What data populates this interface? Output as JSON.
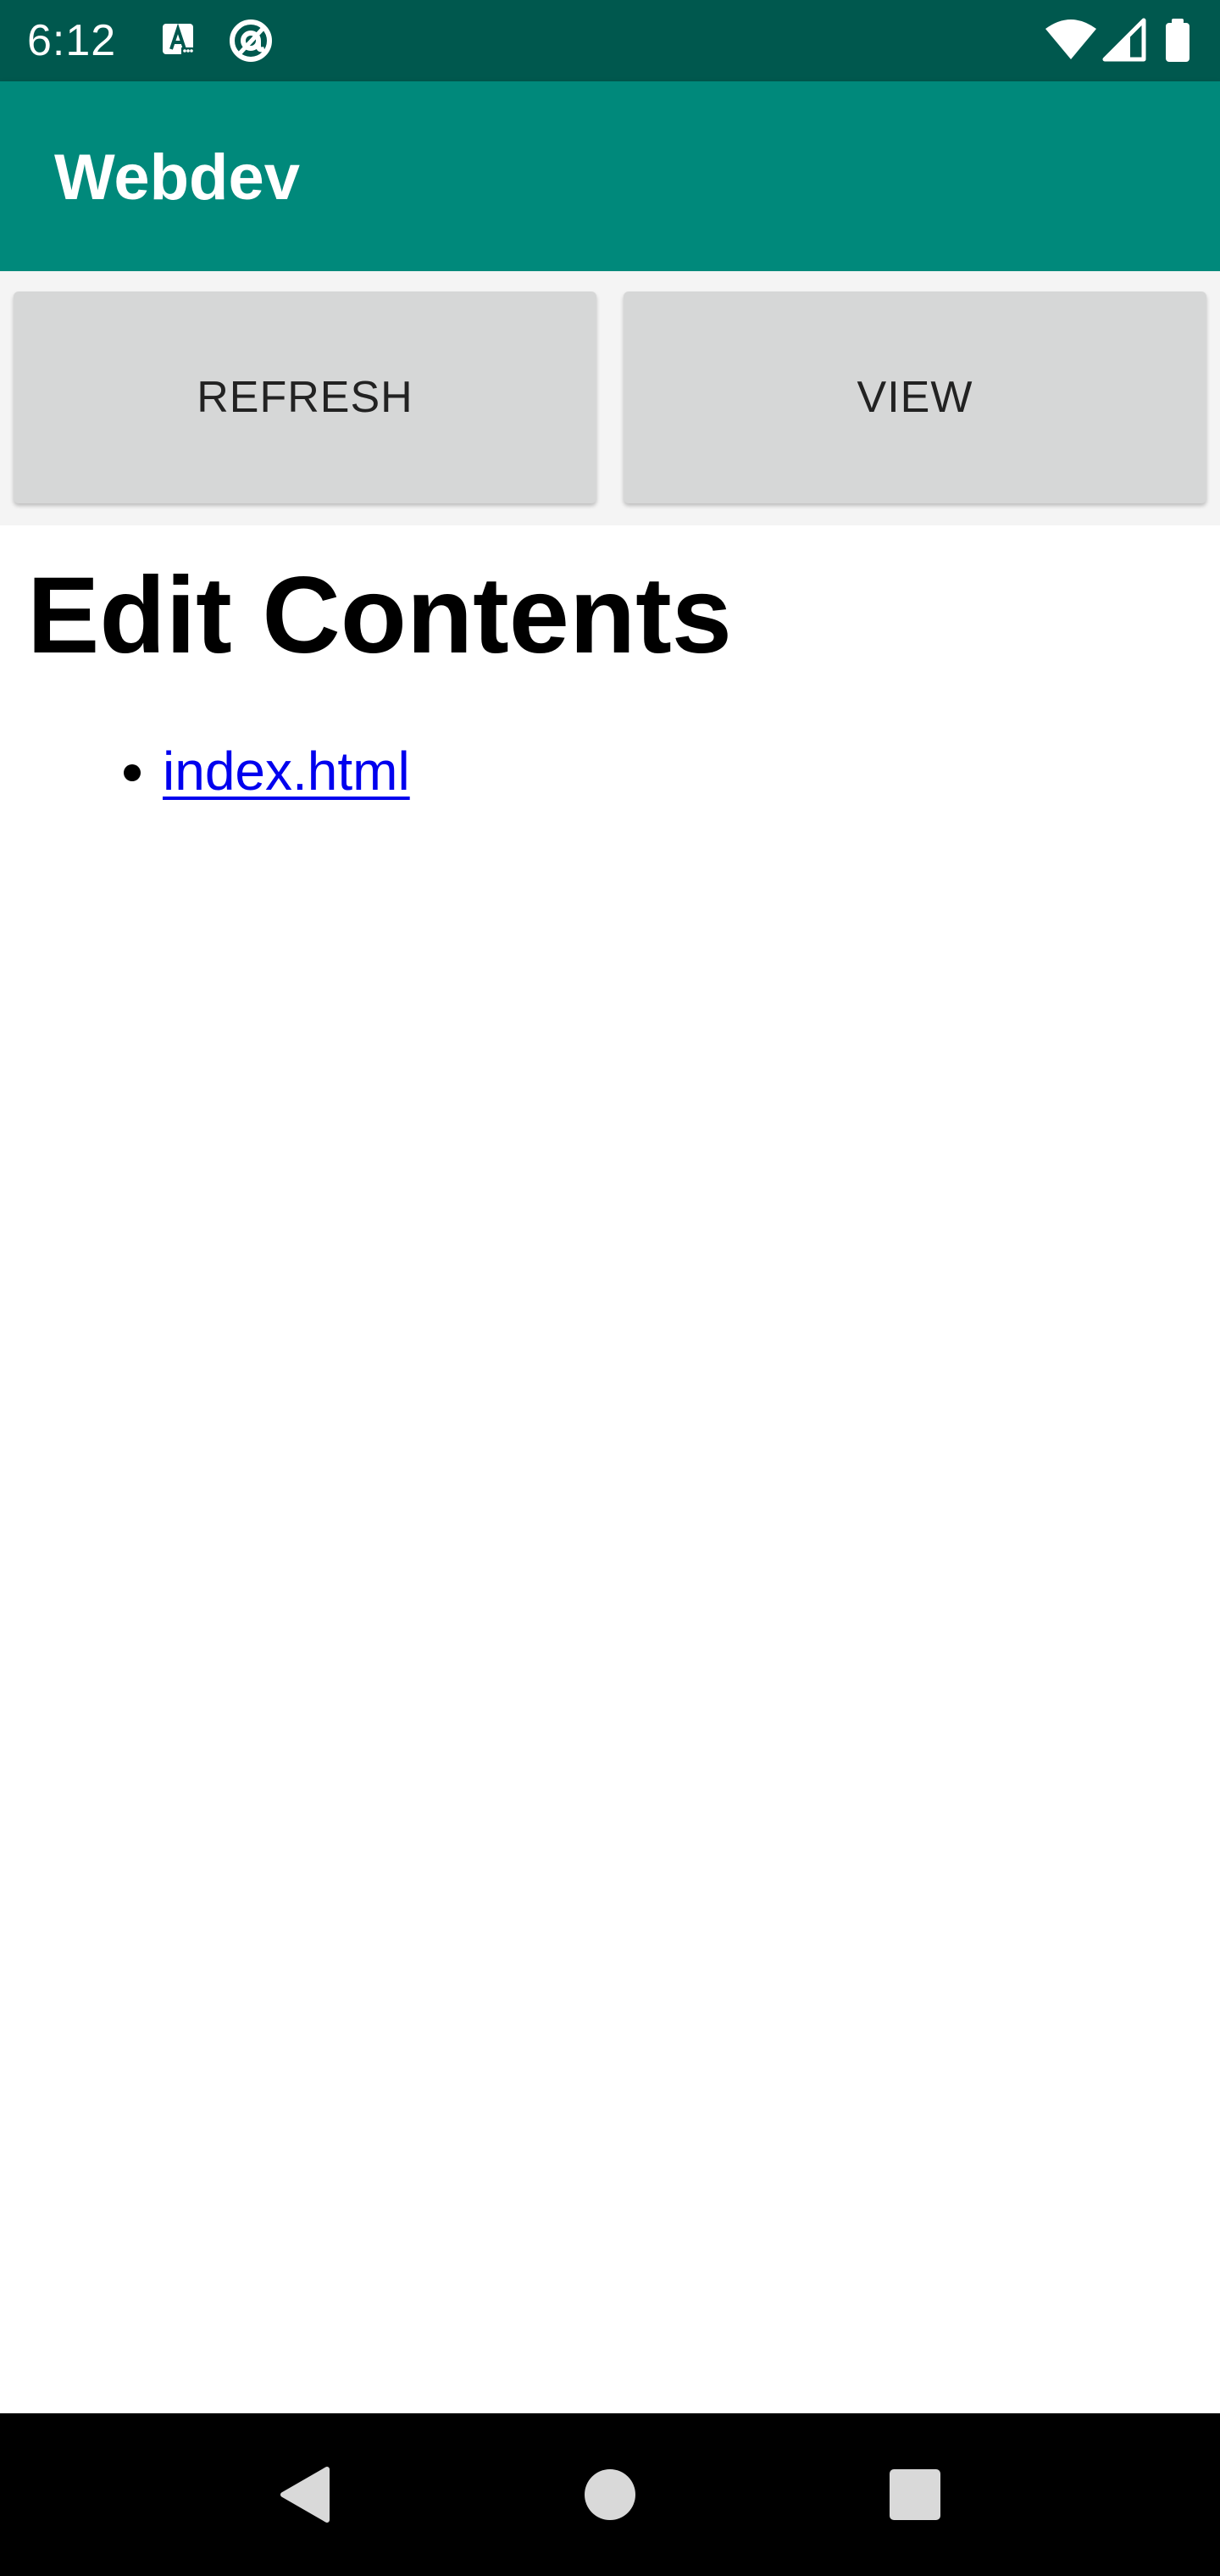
{
  "status_bar": {
    "time": "6:12",
    "left_icons": [
      "keyboard-a-icon",
      "at-sign-icon"
    ],
    "right_icons": [
      "wifi-icon",
      "cellular-signal-icon",
      "battery-icon"
    ],
    "background_color": "#00584e"
  },
  "app_bar": {
    "title": "Webdev",
    "background_color": "#00897b"
  },
  "toolbar": {
    "refresh_label": "REFRESH",
    "view_label": "VIEW"
  },
  "content": {
    "heading": "Edit Contents",
    "files": [
      {
        "name": "index.html"
      }
    ],
    "link_color": "#0000ee"
  },
  "nav_bar": {
    "buttons": [
      "back-icon",
      "home-icon",
      "recents-icon"
    ]
  }
}
